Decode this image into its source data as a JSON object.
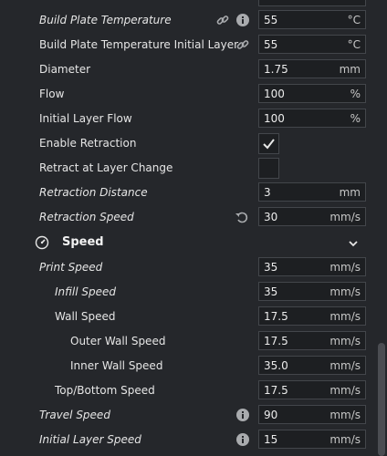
{
  "rows": [
    {
      "label": "Build Plate Temperature",
      "value": "55",
      "unit": "°C"
    },
    {
      "label": "Build Plate Temperature Initial Layer",
      "value": "55",
      "unit": "°C"
    },
    {
      "label": "Diameter",
      "value": "1.75",
      "unit": "mm"
    },
    {
      "label": "Flow",
      "value": "100",
      "unit": "%"
    },
    {
      "label": "Initial Layer Flow",
      "value": "100",
      "unit": "%"
    },
    {
      "label": "Enable Retraction",
      "checked": true
    },
    {
      "label": "Retract at Layer Change",
      "checked": false
    },
    {
      "label": "Retraction Distance",
      "value": "3",
      "unit": "mm"
    },
    {
      "label": "Retraction Speed",
      "value": "30",
      "unit": "mm/s"
    }
  ],
  "section": {
    "title": "Speed",
    "icon": "speedometer-icon",
    "expanded": true
  },
  "speed_rows": [
    {
      "label": "Print Speed",
      "value": "35",
      "unit": "mm/s"
    },
    {
      "label": "Infill Speed",
      "value": "35",
      "unit": "mm/s"
    },
    {
      "label": "Wall Speed",
      "value": "17.5",
      "unit": "mm/s"
    },
    {
      "label": "Outer Wall Speed",
      "value": "17.5",
      "unit": "mm/s"
    },
    {
      "label": "Inner Wall Speed",
      "value": "35.0",
      "unit": "mm/s"
    },
    {
      "label": "Top/Bottom Speed",
      "value": "17.5",
      "unit": "mm/s"
    },
    {
      "label": "Travel Speed",
      "value": "90",
      "unit": "mm/s"
    },
    {
      "label": "Initial Layer Speed",
      "value": "15",
      "unit": "mm/s"
    }
  ],
  "colors": {
    "background": "#25272b",
    "field": "#1d1f22",
    "border": "#43464b",
    "text": "#e6e6e6",
    "icon": "#a9abae"
  }
}
